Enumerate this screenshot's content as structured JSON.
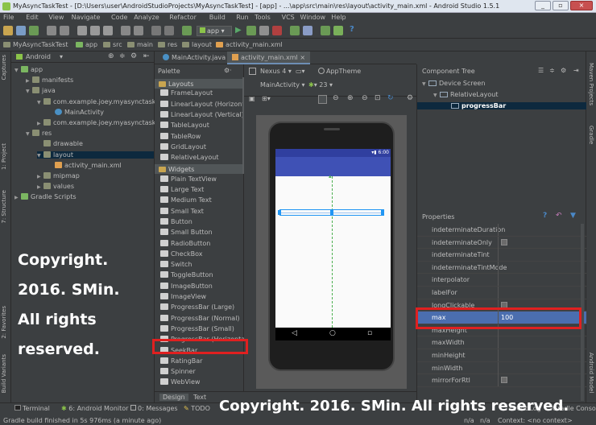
{
  "window": {
    "title": "MyAsyncTaskTest - [D:\\Users\\user\\AndroidStudioProjects\\MyAsyncTaskTest] - [app] - ...\\app\\src\\main\\res\\layout\\activity_main.xml - Android Studio 1.5.1",
    "min": "_",
    "max": "▫",
    "close": "×"
  },
  "menu": [
    "File",
    "Edit",
    "View",
    "Navigate",
    "Code",
    "Analyze",
    "Refactor",
    "Build",
    "Run",
    "Tools",
    "VCS",
    "Window",
    "Help"
  ],
  "toolbar": {
    "run_config": "app"
  },
  "nav": [
    "MyAsyncTaskTest",
    "app",
    "src",
    "main",
    "res",
    "layout",
    "activity_main.xml"
  ],
  "left_tools": [
    "1: Project",
    "7: Structure",
    "Captures",
    "2: Favorites",
    "Build Variants"
  ],
  "right_tools": [
    "Maven Projects",
    "Gradle",
    "Android Model"
  ],
  "project": {
    "view": "Android",
    "tree": [
      {
        "label": "app",
        "level": 0,
        "type": "module",
        "arrow": "▼"
      },
      {
        "label": "manifests",
        "level": 1,
        "type": "folder",
        "arrow": "▶"
      },
      {
        "label": "java",
        "level": 1,
        "type": "folder",
        "arrow": "▼"
      },
      {
        "label": "com.example.joey.myasynctasktest",
        "level": 2,
        "type": "package",
        "arrow": "▼"
      },
      {
        "label": "MainActivity",
        "level": 3,
        "type": "class",
        "arrow": ""
      },
      {
        "label": "com.example.joey.myasynctasktest (",
        "level": 2,
        "type": "package",
        "arrow": "▶"
      },
      {
        "label": "res",
        "level": 1,
        "type": "folder",
        "arrow": "▼"
      },
      {
        "label": "drawable",
        "level": 2,
        "type": "folder",
        "arrow": ""
      },
      {
        "label": "layout",
        "level": 2,
        "type": "folder",
        "arrow": "▼"
      },
      {
        "label": "activity_main.xml",
        "level": 3,
        "type": "file",
        "arrow": ""
      },
      {
        "label": "mipmap",
        "level": 2,
        "type": "folder",
        "arrow": "▶"
      },
      {
        "label": "values",
        "level": 2,
        "type": "folder",
        "arrow": "▶"
      },
      {
        "label": "Gradle Scripts",
        "level": 0,
        "type": "gradle",
        "arrow": "▶"
      }
    ]
  },
  "editor_tabs": [
    {
      "label": "MainActivity.java",
      "active": false
    },
    {
      "label": "activity_main.xml",
      "active": true
    }
  ],
  "palette": {
    "title": "Palette",
    "sections": [
      {
        "name": "Layouts",
        "items": [
          "FrameLayout",
          "LinearLayout (Horizontal",
          "LinearLayout (Vertical)",
          "TableLayout",
          "TableRow",
          "GridLayout",
          "RelativeLayout"
        ]
      },
      {
        "name": "Widgets",
        "items": [
          "Plain TextView",
          "Large Text",
          "Medium Text",
          "Small Text",
          "Button",
          "Small Button",
          "RadioButton",
          "CheckBox",
          "Switch",
          "ToggleButton",
          "ImageButton",
          "ImageView",
          "ProgressBar (Large)",
          "ProgressBar (Normal)",
          "ProgressBar (Small)",
          "ProgressBar (Horizontal)",
          "SeekBar",
          "RatingBar",
          "Spinner",
          "WebView"
        ]
      }
    ]
  },
  "design_toolbar": {
    "device": "Nexus 4",
    "theme": "AppTheme",
    "activity": "MainActivity",
    "api": "23"
  },
  "device_preview": {
    "clock": "6:00"
  },
  "bottom_tabs": [
    "Design",
    "Text"
  ],
  "component_tree": {
    "title": "Component Tree",
    "items": [
      {
        "label": "Device Screen",
        "level": 0
      },
      {
        "label": "RelativeLayout",
        "level": 1
      },
      {
        "label": "progressBar",
        "level": 2,
        "selected": true
      }
    ]
  },
  "properties": {
    "title": "Properties",
    "rows": [
      {
        "name": "indeterminateDuration",
        "value": ""
      },
      {
        "name": "indeterminateOnly",
        "value": "",
        "checkbox": true
      },
      {
        "name": "indeterminateTint",
        "value": ""
      },
      {
        "name": "indeterminateTintMode",
        "value": ""
      },
      {
        "name": "interpolator",
        "value": ""
      },
      {
        "name": "labelFor",
        "value": ""
      },
      {
        "name": "longClickable",
        "value": "",
        "checkbox": true
      },
      {
        "name": "max",
        "value": "100",
        "selected": true
      },
      {
        "name": "maxHeight",
        "value": ""
      },
      {
        "name": "maxWidth",
        "value": ""
      },
      {
        "name": "minHeight",
        "value": ""
      },
      {
        "name": "minWidth",
        "value": ""
      },
      {
        "name": "mirrorForRtl",
        "value": "",
        "checkbox": true
      }
    ]
  },
  "statusbar": {
    "tools": [
      "Terminal",
      "6: Android Monitor",
      "0: Messages",
      "TODO"
    ],
    "right_tools": [
      "Event Log",
      "Gradle Console"
    ],
    "message": "Gradle build finished in 5s 976ms (a minute ago)",
    "right_info": [
      "n/a",
      "n/a",
      "Context: <no context>"
    ]
  },
  "watermark": {
    "left_lines": [
      "Copyright.",
      "2016. SMin.",
      "All rights",
      "reserved."
    ],
    "bottom": "Copyright. 2016. SMin. All rights reserved."
  },
  "colors": {
    "ide_bg": "#3c3f41",
    "app_bar": "#3f51b5",
    "selection": "#4b6eaf",
    "highlight_box": "#e02020"
  }
}
